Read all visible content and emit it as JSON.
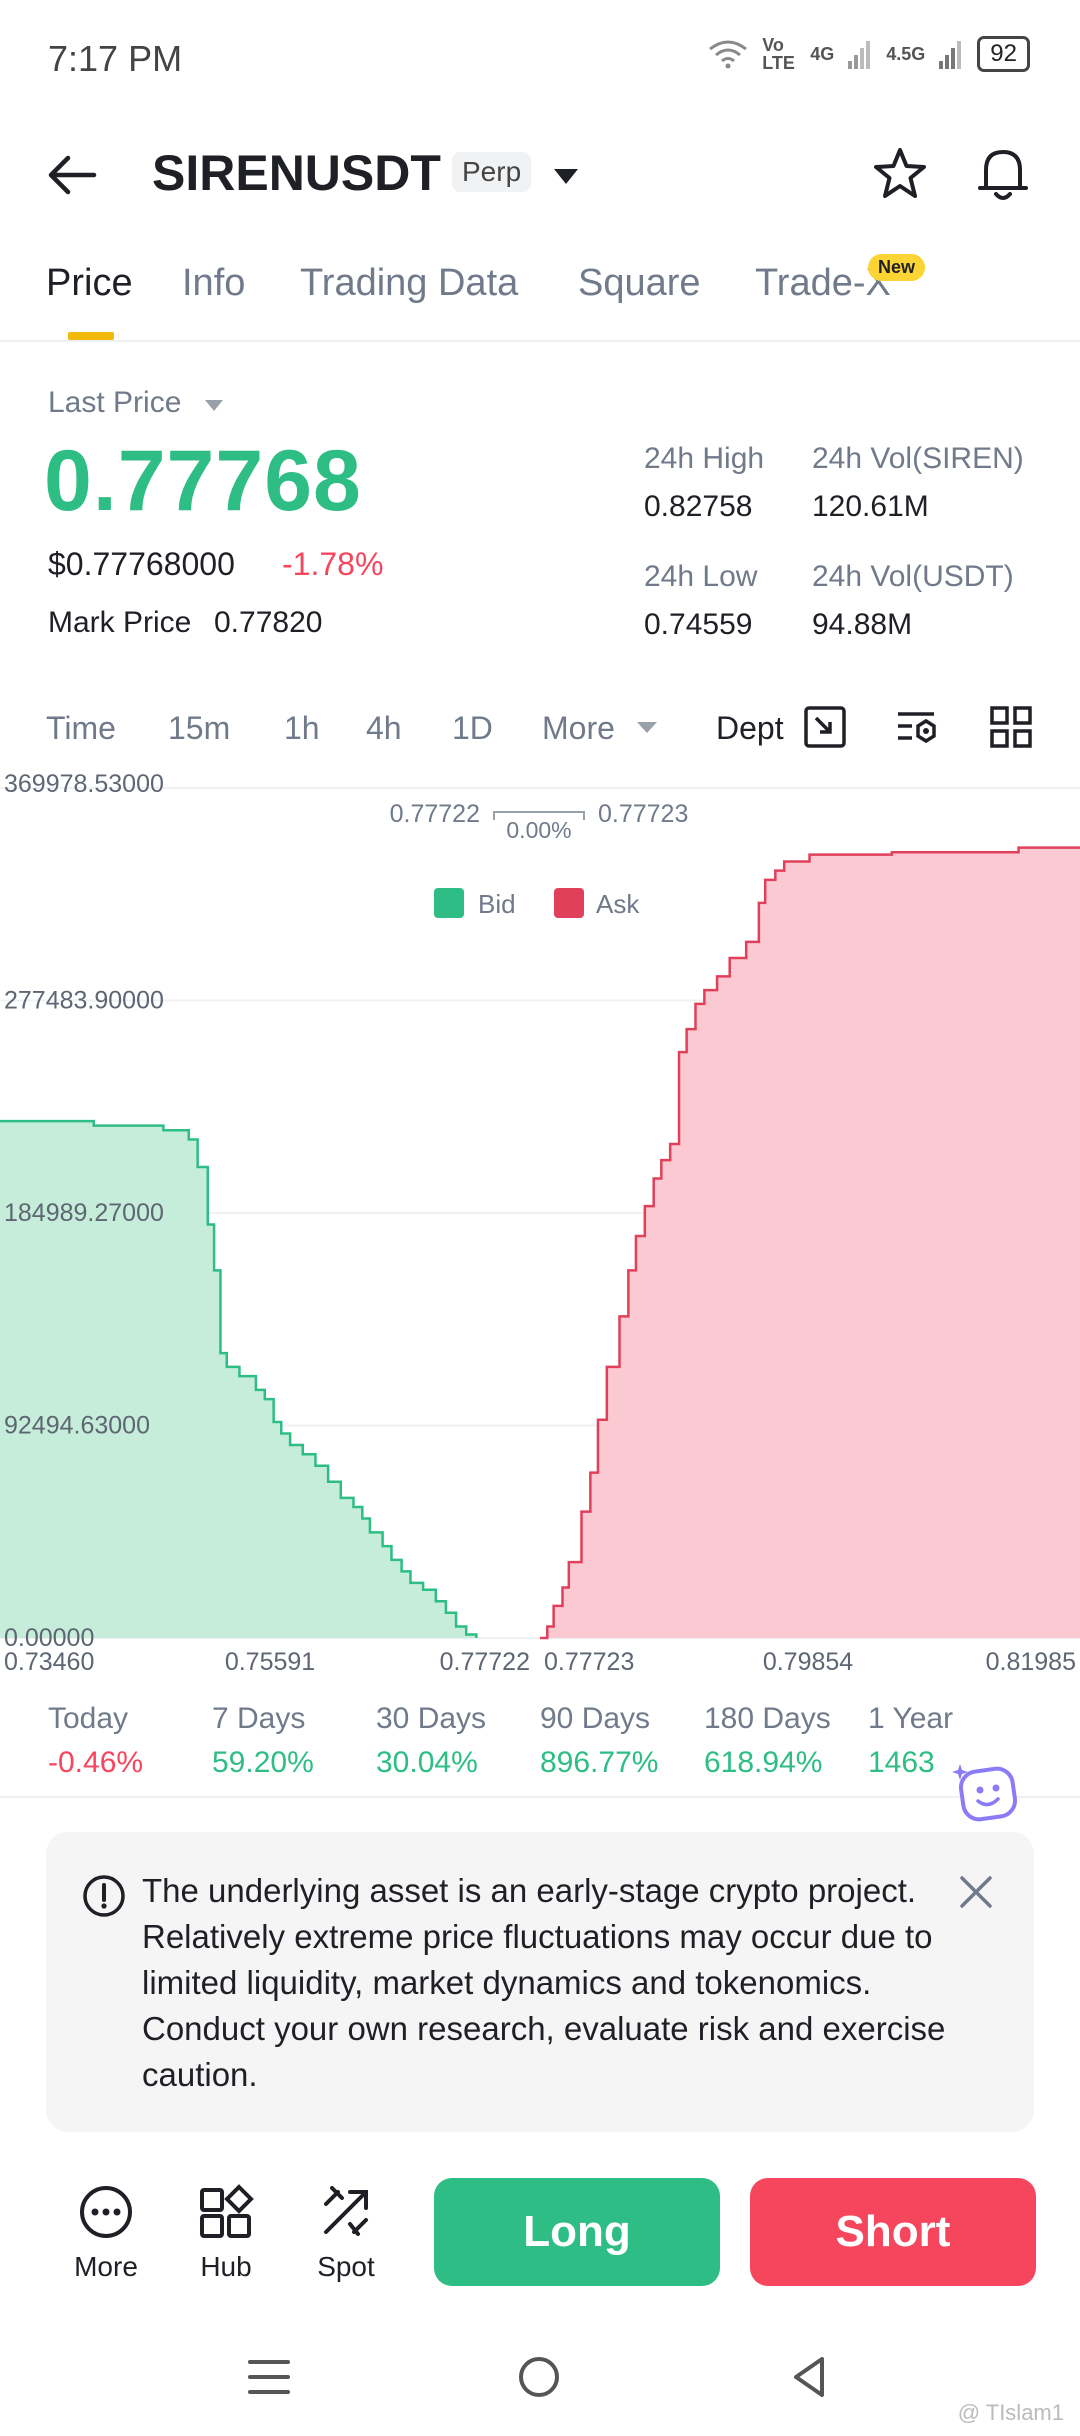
{
  "status_bar": {
    "time": "7:17 PM",
    "volte": "Vo LTE",
    "net1": "4G",
    "net2": "4.5G",
    "battery": "92"
  },
  "header": {
    "symbol": "SIRENUSDT",
    "badge": "Perp"
  },
  "tabs": [
    {
      "label": "Price",
      "active": true
    },
    {
      "label": "Info"
    },
    {
      "label": "Trading Data"
    },
    {
      "label": "Square"
    },
    {
      "label": "Trade-X"
    }
  ],
  "new_badge": "New",
  "price": {
    "last_price_label": "Last Price",
    "last_price": "0.77768",
    "usd_price": "$0.77768000",
    "change": "-1.78%",
    "mark_label": "Mark Price",
    "mark_value": "0.77820"
  },
  "stats": {
    "high_label": "24h High",
    "high_value": "0.82758",
    "vol_siren_label": "24h Vol(SIREN)",
    "vol_siren_value": "120.61M",
    "low_label": "24h Low",
    "low_value": "0.74559",
    "vol_usdt_label": "24h Vol(USDT)",
    "vol_usdt_value": "94.88M"
  },
  "intervals": [
    "Time",
    "15m",
    "1h",
    "4h",
    "1D",
    "More"
  ],
  "depth_label": "Dept",
  "chart_data": {
    "type": "area",
    "legend": [
      "Bid",
      "Ask"
    ],
    "colors": {
      "bid_line": "#2ebd85",
      "bid_fill": "#c6edd9",
      "ask_line": "#e0405a",
      "ask_fill": "#fbc9d1"
    },
    "spread": {
      "bid": "0.77722",
      "ask": "0.77723",
      "pct": "0.00%"
    },
    "y_ticks": [
      "369978.53000",
      "277483.90000",
      "184989.27000",
      "92494.63000",
      "0.00000"
    ],
    "x_ticks": [
      "0.73460",
      "0.75591",
      "0.77722",
      "0.77723",
      "0.79854",
      "0.81985"
    ],
    "ylim": [
      0,
      369978.53
    ],
    "xlim": [
      0.7346,
      0.81985
    ],
    "bid": {
      "x": [
        0.7346,
        0.742,
        0.7475,
        0.7495,
        0.7502,
        0.751,
        0.7515,
        0.752,
        0.7525,
        0.7535,
        0.7548,
        0.7555,
        0.7562,
        0.7568,
        0.7575,
        0.7585,
        0.7595,
        0.7605,
        0.7615,
        0.7625,
        0.7632,
        0.7638,
        0.7648,
        0.7655,
        0.7663,
        0.767,
        0.768,
        0.769,
        0.7698,
        0.7706,
        0.7714,
        0.7722
      ],
      "y": [
        225000,
        223000,
        221000,
        217000,
        205000,
        180000,
        160000,
        124000,
        118000,
        114000,
        108000,
        104000,
        94000,
        89000,
        84000,
        80000,
        75000,
        68000,
        61000,
        57000,
        52000,
        46000,
        40000,
        34000,
        29000,
        24000,
        21000,
        16000,
        11000,
        5000,
        1500,
        0
      ]
    },
    "ask": {
      "x": [
        0.77723,
        0.7778,
        0.7783,
        0.779,
        0.7795,
        0.7805,
        0.7812,
        0.7818,
        0.7825,
        0.7835,
        0.7842,
        0.7848,
        0.7855,
        0.7862,
        0.7868,
        0.7875,
        0.7882,
        0.7888,
        0.7895,
        0.7902,
        0.7912,
        0.7922,
        0.7935,
        0.7945,
        0.795,
        0.7958,
        0.7965,
        0.7985,
        0.805,
        0.815,
        0.81985
      ],
      "y": [
        0,
        5000,
        14000,
        22000,
        33000,
        55000,
        72000,
        95000,
        118000,
        140000,
        160000,
        175000,
        188000,
        200000,
        208000,
        215000,
        255000,
        265000,
        276000,
        282000,
        288000,
        296000,
        303000,
        320000,
        330000,
        334000,
        338000,
        341000,
        342000,
        344000,
        344000
      ]
    }
  },
  "performance": [
    {
      "label": "Today",
      "value": "-0.46%"
    },
    {
      "label": "7 Days",
      "value": "59.20%"
    },
    {
      "label": "30 Days",
      "value": "30.04%"
    },
    {
      "label": "90 Days",
      "value": "896.77%"
    },
    {
      "label": "180 Days",
      "value": "618.94%"
    },
    {
      "label": "1 Year",
      "value": "1463"
    }
  ],
  "warning": "The underlying asset is an early-stage crypto project. Relatively extreme price fluctuations may occur due to limited liquidity, market dynamics and tokenomics. Conduct your own research, evaluate risk and exercise caution.",
  "actions": {
    "more": "More",
    "hub": "Hub",
    "spot": "Spot",
    "long": "Long",
    "short": "Short"
  },
  "watermark": "@ TIslam1"
}
